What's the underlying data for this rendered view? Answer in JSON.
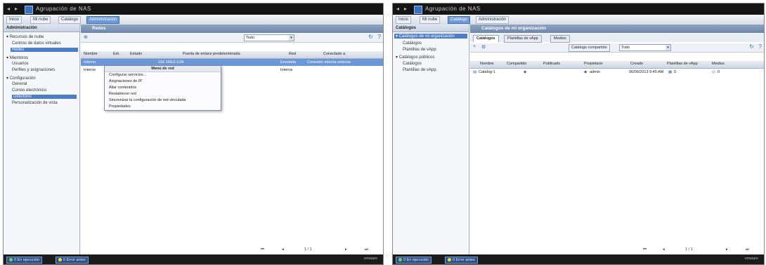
{
  "left": {
    "window_title": "Agrupación de NAS",
    "menu": [
      "Inicio",
      "Mi nube",
      "Catálogo",
      "Administración"
    ],
    "sidebar": {
      "header": "Administración",
      "items": [
        {
          "label": "Recursos de nube"
        },
        {
          "label": "Centros de datos virtuales"
        },
        {
          "label": "Redes"
        },
        {
          "label": "Miembros"
        },
        {
          "label": "Usuarios"
        },
        {
          "label": "Perfiles y asignaciones"
        },
        {
          "label": "Configuración"
        },
        {
          "label": "General"
        },
        {
          "label": "Correo electrónico"
        },
        {
          "label": "Directorio"
        },
        {
          "label": "Personalización de vista"
        }
      ]
    },
    "panel_title": "Redes",
    "filter": "Todo",
    "columns": [
      "Nombre",
      "Est.",
      "Estado",
      "Puerta de enlace predeterminada",
      "Red",
      "Conectado a"
    ],
    "rows": [
      {
        "name": "Interno",
        "status": "",
        "gateway": "192.168.0.1/24",
        "net": "Enrutada",
        "conn": "Conexión interna externa"
      },
      {
        "name": "Interno",
        "status": "",
        "gateway": "",
        "net": "Interna",
        "conn": ""
      }
    ],
    "context_menu": {
      "title": "Menú de red",
      "items": [
        "Configurar servicios...",
        "Asignaciones de IP",
        "Aliar contenidos",
        "Restablecer red",
        "Sincronizar la configuración de red vinculada",
        "Propiedades"
      ]
    },
    "pager": "1 / 1",
    "taskbar": {
      "running": "0 En ejecución",
      "errors": "0 Error antes"
    },
    "clock": "vmware"
  },
  "right": {
    "window_title": "Agrupación de NAS",
    "menu": [
      "Inicio",
      "Mi nube",
      "Catálogo",
      "Administración"
    ],
    "sidebar": {
      "header": "Catálogos",
      "items": [
        {
          "label": "Catálogos de mi organización"
        },
        {
          "label": "Catálogos"
        },
        {
          "label": "Plantillas de vApp"
        },
        {
          "label": "Catálogos públicos"
        },
        {
          "label": "Catálogos"
        },
        {
          "label": "Plantillas de vApp"
        }
      ]
    },
    "panel_title": "Catálogos de mi organización",
    "tabs": [
      "Catálogos",
      "Plantillas de vApp",
      "Medios"
    ],
    "buttons": {
      "share": "Catálogo compartido",
      "filter": "Todo"
    },
    "columns": [
      "Nombre",
      "Compartido",
      "Publicado",
      "Propietario",
      "Creado",
      "Plantillas de vApp",
      "Medios"
    ],
    "rows": [
      {
        "name": "Catalog-1",
        "shared": "",
        "published": "",
        "owner": "admin",
        "created": "06/06/2013 9:45 AM",
        "vapps": "0",
        "media": "0"
      }
    ],
    "pager": "1 / 1",
    "taskbar": {
      "running": "0 En ejecución",
      "errors": "0 Error antes"
    },
    "clock": "vmware"
  }
}
